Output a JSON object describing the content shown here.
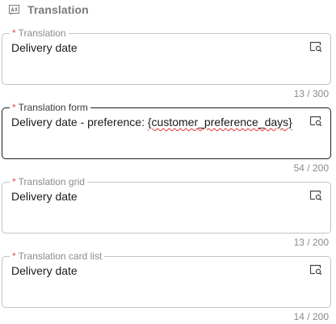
{
  "section": {
    "title": "Translation",
    "icon": "translate-icon"
  },
  "fields": [
    {
      "required_mark": "*",
      "label": "Translation",
      "value": "Delivery date",
      "counter": "13 / 300",
      "action_icon": "search-window-icon"
    },
    {
      "required_mark": "*",
      "label": "Translation form",
      "value_prefix": "Delivery date - preference: ",
      "value_token": "{customer_preference_days}",
      "counter": "54 / 200",
      "action_icon": "search-window-icon",
      "focused": true
    },
    {
      "required_mark": "*",
      "label": "Translation grid",
      "value": "Delivery date",
      "counter": "13 / 200",
      "action_icon": "search-window-icon"
    },
    {
      "required_mark": "*",
      "label": "Translation card list",
      "value": "Delivery date",
      "counter": "14 / 200",
      "action_icon": "search-window-icon"
    }
  ],
  "colors": {
    "required": "#d9534f",
    "spellcheck": "#e0332f",
    "border": "#c2c2c2",
    "border_focused": "#1f1f1f",
    "muted_text": "#8a8a8a"
  }
}
